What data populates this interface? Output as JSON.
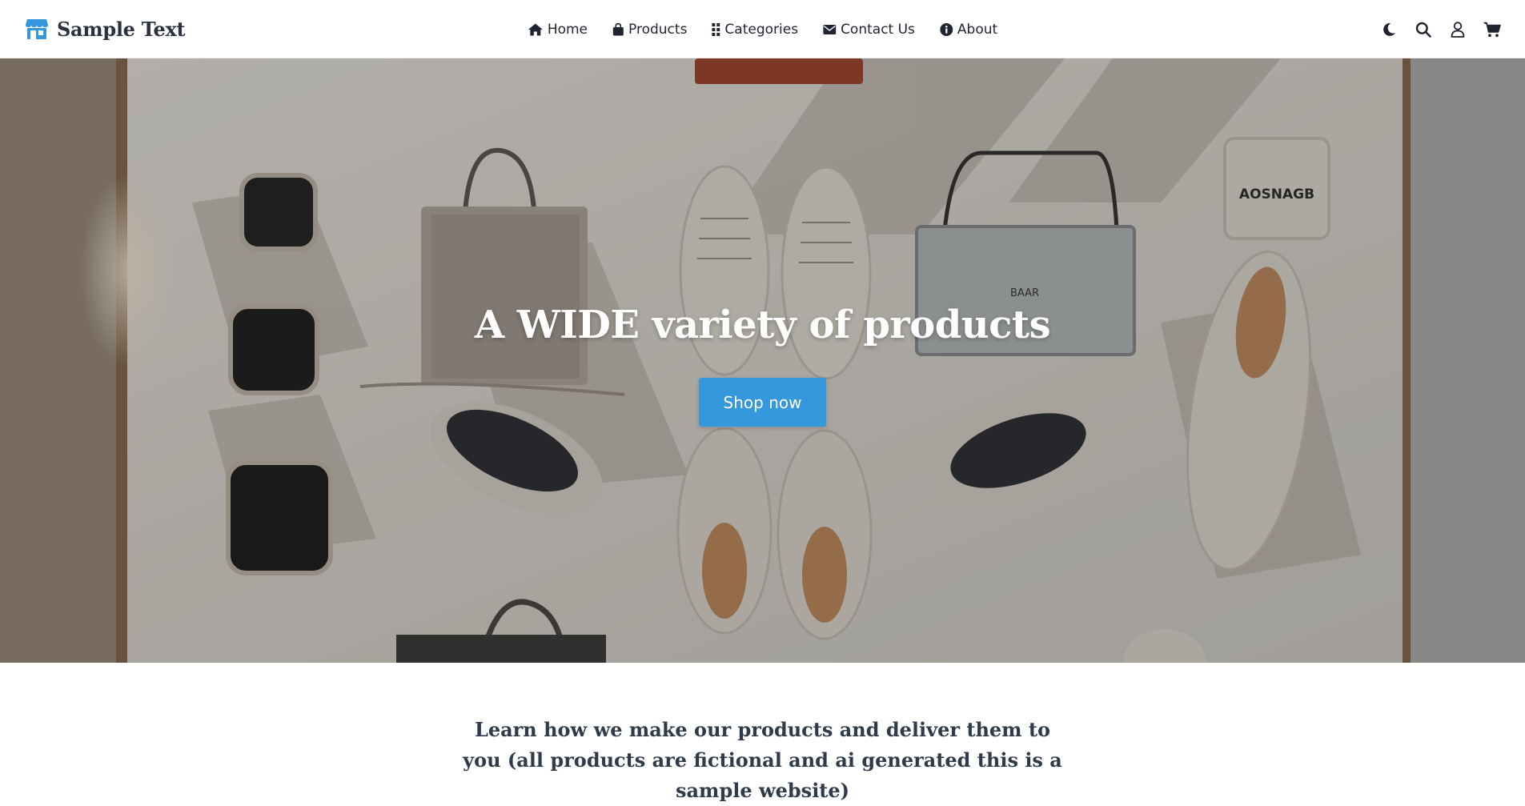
{
  "navbar": {
    "brand": {
      "name": "Sample Text",
      "icon": "store-icon",
      "icon_color": "#3598dc"
    },
    "links": [
      {
        "label": "Home",
        "icon": "home-icon"
      },
      {
        "label": "Products",
        "icon": "shopping-bag-icon"
      },
      {
        "label": "Categories",
        "icon": "grid-icon"
      },
      {
        "label": "Contact Us",
        "icon": "envelope-icon"
      },
      {
        "label": "About",
        "icon": "info-circle-icon"
      }
    ],
    "actions": [
      {
        "icon": "moon-icon"
      },
      {
        "icon": "search-icon"
      },
      {
        "icon": "user-icon"
      },
      {
        "icon": "cart-icon"
      }
    ]
  },
  "hero": {
    "title": "A WIDE variety of products",
    "button_label": "Shop now",
    "button_color": "#3598dc",
    "background": "flat-lay-products-photo",
    "box_labels": [
      "AOSNAGB",
      "BAAR"
    ]
  },
  "intro": {
    "text": "Learn how we make our products and deliver them to you (all products are fictional and ai generated this is a sample website)"
  }
}
